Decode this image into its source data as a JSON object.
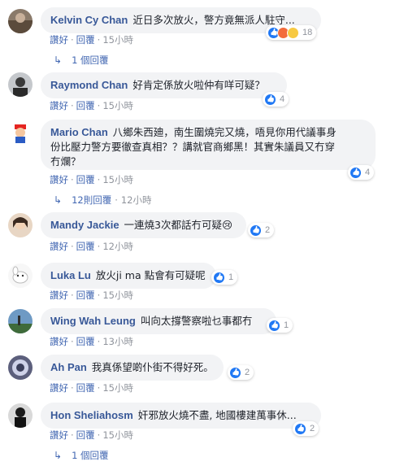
{
  "actions": {
    "like": "讚好",
    "reply": "回覆",
    "dot": "·"
  },
  "comments": [
    {
      "name": "Kelvin Cy Chan",
      "text": "近日多次放火，警方竟無派人駐守...",
      "reactions": "18",
      "time": "15小時",
      "replies": "1 個回覆"
    },
    {
      "name": "Raymond Chan",
      "text": "好肯定係放火啦仲有咩可疑？",
      "reactions": "4",
      "time": "15小時"
    },
    {
      "name": "Mario Chan",
      "text_lines": [
        "八鄉朱西廸，南生圍燒完又燒，唔見你用代議事身",
        "份比壓力警方要徹查真相？？講就官商鄉黑！其實朱議員又冇穿",
        "冇爛？"
      ],
      "reactions": "4",
      "time": "15小時",
      "replies": "12則回覆",
      "replies_time": "12小時"
    },
    {
      "name": "Mandy Jackie",
      "text": "一連燒3次都話冇可疑😢",
      "reactions": "2",
      "time": "12小時"
    },
    {
      "name": "Luka Lu",
      "text": "放火ji ma 點會有可疑呢",
      "reactions": "1",
      "time": "15小時"
    },
    {
      "name": "Wing Wah Leung",
      "text": "叫向太撐警察啦乜事都冇",
      "reactions": "1",
      "time": "13小時"
    },
    {
      "name": "Ah Pan",
      "text": "我真係望啲仆街不得好死。",
      "reactions": "2",
      "time": "15小時"
    },
    {
      "name": "Hon Sheliahosm",
      "text": "奸邪放火燒不盡, 地國樓建萬事休...",
      "reactions": "2",
      "time": "15小時",
      "replies": "1 個回覆"
    }
  ]
}
